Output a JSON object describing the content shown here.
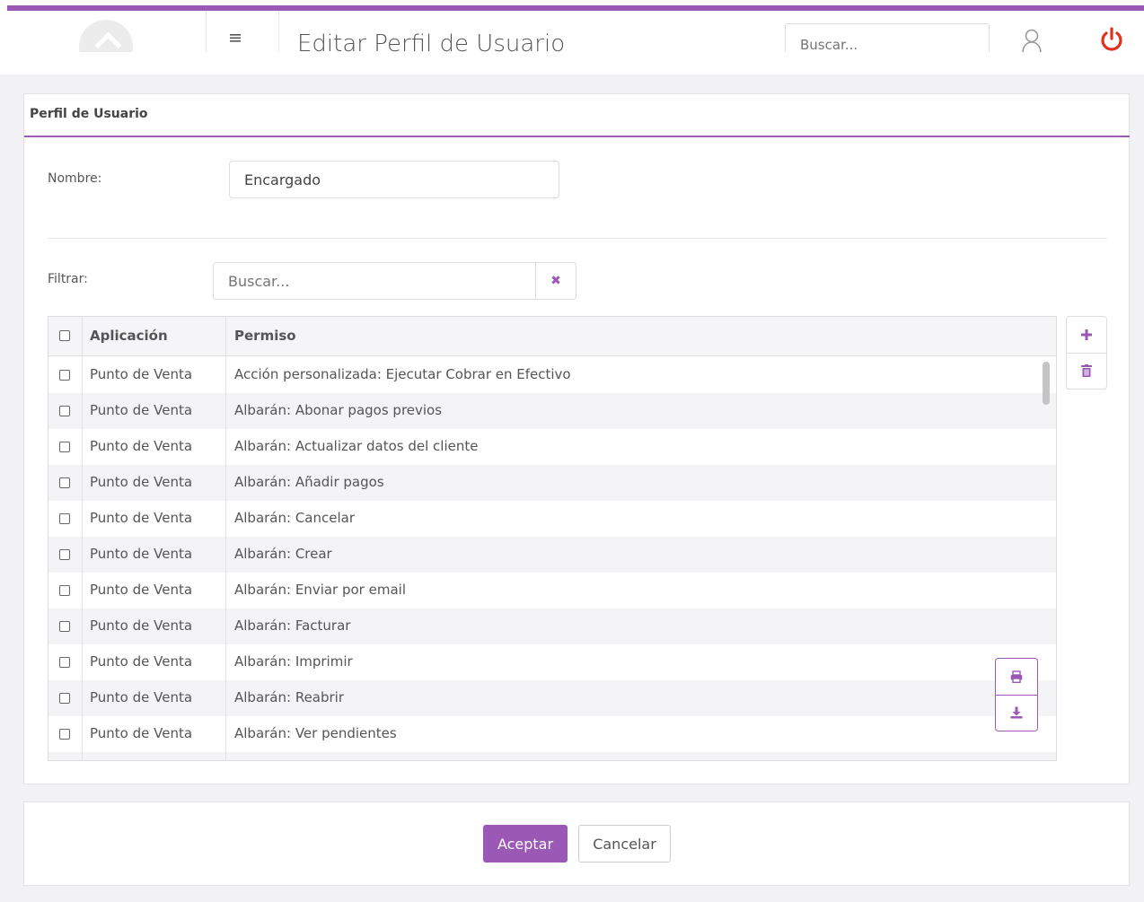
{
  "header": {
    "title": "Editar Perfil de Usuario",
    "search_placeholder": "Buscar...",
    "accent_color": "#9b59b6",
    "power_color": "#e22f1f"
  },
  "panel": {
    "title": "Perfil de Usuario",
    "name_label": "Nombre:",
    "name_value": "Encargado",
    "filter_label": "Filtrar:",
    "filter_placeholder": "Buscar..."
  },
  "table": {
    "columns": [
      "Aplicación",
      "Permiso"
    ],
    "rows": [
      {
        "app": "Punto de Venta",
        "perm": "Acción personalizada: Ejecutar Cobrar en Efectivo"
      },
      {
        "app": "Punto de Venta",
        "perm": "Albarán: Abonar pagos previos"
      },
      {
        "app": "Punto de Venta",
        "perm": "Albarán: Actualizar datos del cliente"
      },
      {
        "app": "Punto de Venta",
        "perm": "Albarán: Añadir pagos"
      },
      {
        "app": "Punto de Venta",
        "perm": "Albarán: Cancelar"
      },
      {
        "app": "Punto de Venta",
        "perm": "Albarán: Crear"
      },
      {
        "app": "Punto de Venta",
        "perm": "Albarán: Enviar por email"
      },
      {
        "app": "Punto de Venta",
        "perm": "Albarán: Facturar"
      },
      {
        "app": "Punto de Venta",
        "perm": "Albarán: Imprimir"
      },
      {
        "app": "Punto de Venta",
        "perm": "Albarán: Reabrir"
      },
      {
        "app": "Punto de Venta",
        "perm": "Albarán: Ver pendientes"
      }
    ]
  },
  "icons": {
    "add": "plus-icon",
    "delete": "trash-icon",
    "print": "print-icon",
    "download": "download-icon",
    "clear": "close-icon",
    "user": "user-icon",
    "power": "power-icon",
    "menu": "hamburger-icon"
  },
  "footer": {
    "accept_label": "Aceptar",
    "cancel_label": "Cancelar"
  }
}
